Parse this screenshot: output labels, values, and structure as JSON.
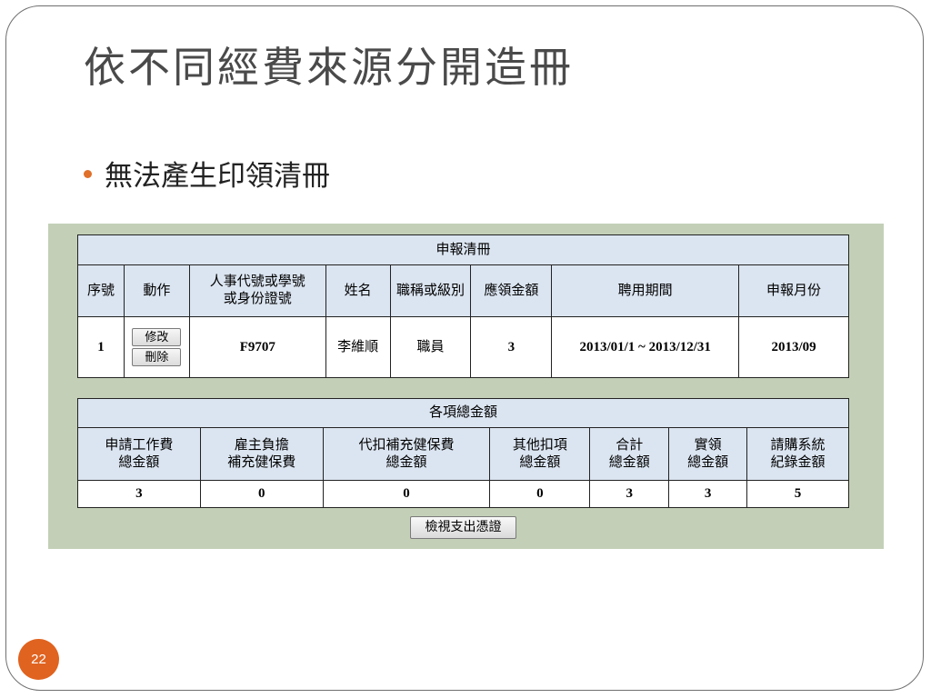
{
  "slide": {
    "title": "依不同經費來源分開造冊",
    "bullet": "無法產生印領清冊",
    "page_number": "22",
    "accent_color": "#e0631f"
  },
  "table1": {
    "caption": "申報清冊",
    "headers": [
      "序號",
      "動作",
      "人事代號或學號或身份證號",
      "姓名",
      "職稱或級別",
      "應領金額",
      "聘用期間",
      "申報月份"
    ],
    "header_lines": {
      "id_line1": "人事代號或學號",
      "id_line2": "或身份證號"
    },
    "row": {
      "seq": "1",
      "edit_button": "修改",
      "delete_button": "刪除",
      "id": "F9707",
      "name": "李維順",
      "title": "職員",
      "amount": "3",
      "period": "2013/01/1 ~ 2013/12/31",
      "month": "2013/09"
    }
  },
  "table2": {
    "caption": "各項總金額",
    "headers": [
      {
        "line1": "申請工作費",
        "line2": "總金額"
      },
      {
        "line1": "雇主負擔",
        "line2": "補充健保費"
      },
      {
        "line1": "代扣補充健保費",
        "line2": "總金額"
      },
      {
        "line1": "其他扣項",
        "line2": "總金額"
      },
      {
        "line1": "合計",
        "line2": "總金額"
      },
      {
        "line1": "實領",
        "line2": "總金額"
      },
      {
        "line1": "請購系統",
        "line2": "紀錄金額"
      }
    ],
    "values": [
      "3",
      "0",
      "0",
      "0",
      "3",
      "3",
      "5"
    ],
    "highlight_color": "#dd0000"
  },
  "view_button": "檢視支出憑證"
}
